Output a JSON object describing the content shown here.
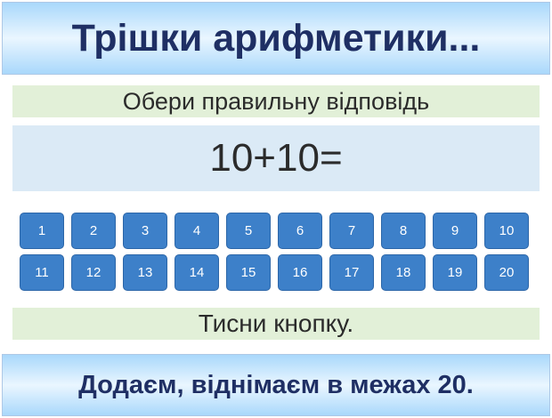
{
  "header": {
    "title": "Трішки арифметики..."
  },
  "instruction": "Обери правильну відповідь",
  "question": "10+10=",
  "answers": [
    "1",
    "2",
    "3",
    "4",
    "5",
    "6",
    "7",
    "8",
    "9",
    "10",
    "11",
    "12",
    "13",
    "14",
    "15",
    "16",
    "17",
    "18",
    "19",
    "20"
  ],
  "hint": "Тисни кнопку.",
  "footer": {
    "text": "Додаєм, віднімаєм в межах 20."
  },
  "colors": {
    "banner_text": "#1f2f64",
    "button_bg": "#3d80c9",
    "instruction_bg": "#e2f0d8",
    "question_bg": "#dbeaf6"
  }
}
